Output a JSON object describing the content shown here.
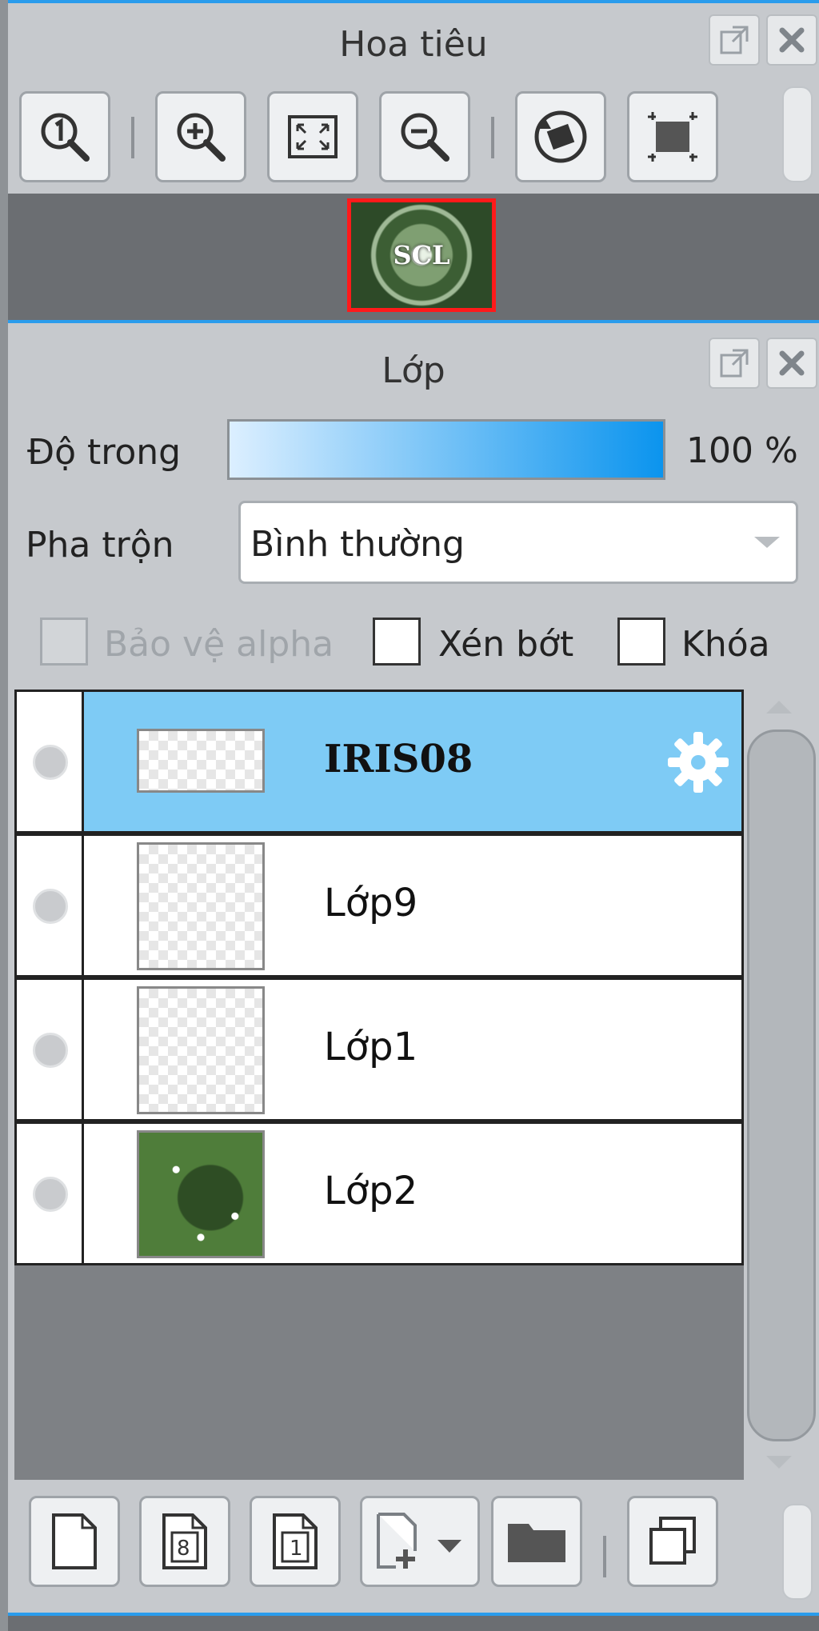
{
  "navigator": {
    "title": "Hoa tiêu",
    "preview_text": "SCL",
    "tools": [
      {
        "icon": "zoom-actual-size-icon"
      },
      {
        "icon": "zoom-in-icon"
      },
      {
        "icon": "fit-to-window-icon"
      },
      {
        "icon": "zoom-out-icon"
      },
      {
        "icon": "rotate-reset-icon"
      },
      {
        "icon": "fit-canvas-icon"
      }
    ]
  },
  "layers_panel": {
    "title": "Lớp",
    "opacity_label": "Độ trong",
    "opacity_value": "100 %",
    "opacity_fraction": 1.0,
    "blend_label": "Pha trộn",
    "blend_value": "Bình thường",
    "checkboxes": {
      "alpha": {
        "label": "Bảo vệ alpha",
        "checked": false,
        "disabled": true
      },
      "clip": {
        "label": "Xén bớt",
        "checked": false
      },
      "lock": {
        "label": "Khóa",
        "checked": false
      }
    },
    "layers": [
      {
        "name": "IRIS08",
        "selected": true,
        "bold": true
      },
      {
        "name": "Lớp9",
        "selected": false
      },
      {
        "name": "Lớp1",
        "selected": false
      },
      {
        "name": "Lớp2",
        "selected": false
      }
    ],
    "bottom_tools": [
      {
        "icon": "new-layer-icon"
      },
      {
        "icon": "new-8bit-layer-icon",
        "badge": "8"
      },
      {
        "icon": "new-1bit-layer-icon",
        "badge": "1"
      },
      {
        "icon": "add-layer-dropdown-icon"
      },
      {
        "icon": "new-folder-icon"
      },
      {
        "icon": "duplicate-layer-icon"
      }
    ]
  },
  "colors": {
    "accent": "#2a9cec",
    "selected_row": "#7ecbf5",
    "highlight_border": "#ff1a1a"
  }
}
